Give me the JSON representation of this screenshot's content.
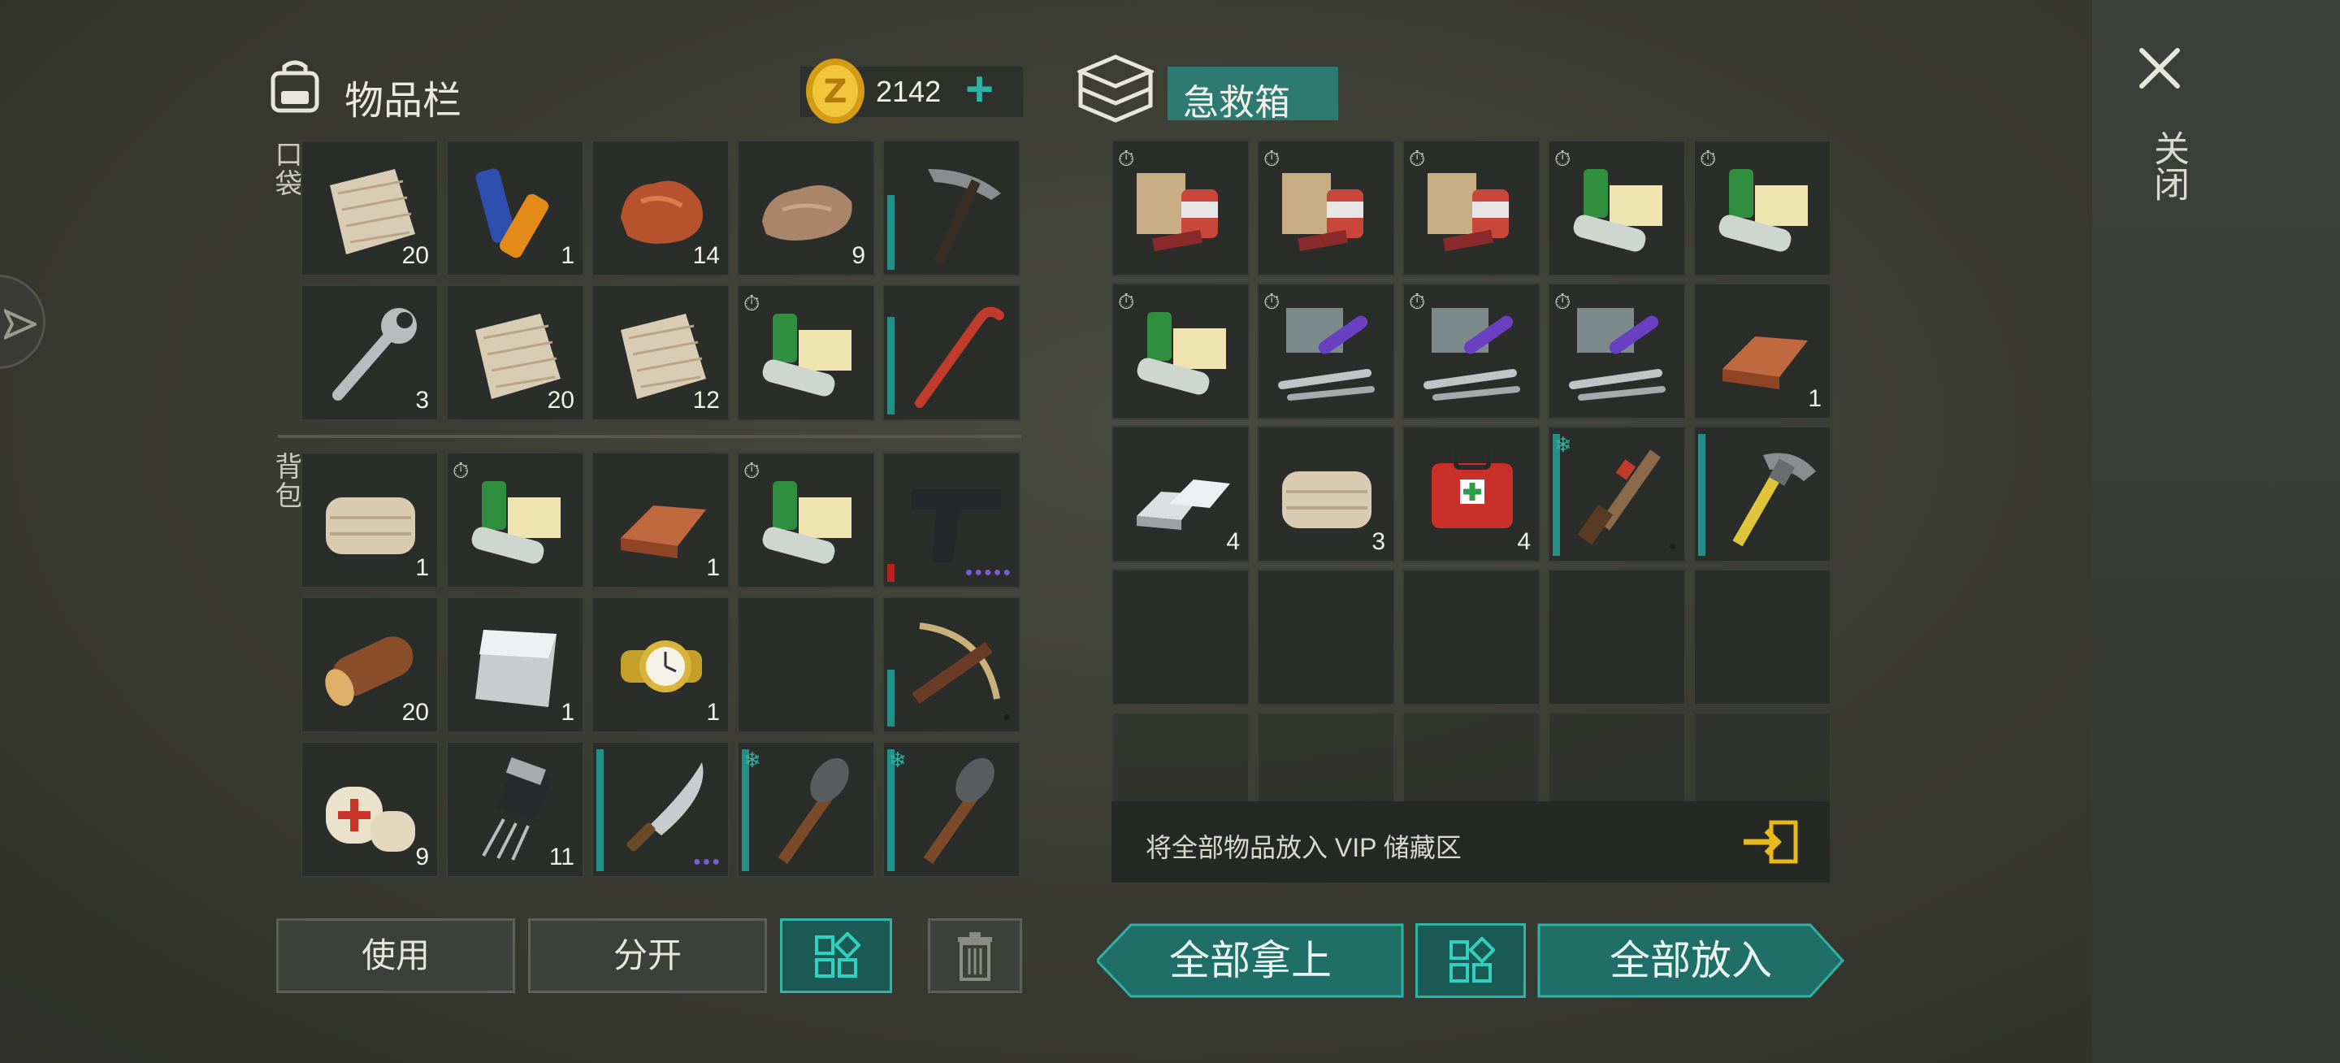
{
  "inventory": {
    "title": "物品栏",
    "coins": "2142",
    "plus": "+",
    "pocket_label": "口袋",
    "backpack_label": "背包",
    "pocket_slots": [
      {
        "icon": "burlap-cloth-icon",
        "count": "20"
      },
      {
        "icon": "batteries-icon",
        "count": "1"
      },
      {
        "icon": "copper-ore-icon",
        "count": "14"
      },
      {
        "icon": "stone-icon",
        "count": "9"
      },
      {
        "icon": "pickaxe-icon",
        "count": ""
      },
      {
        "icon": "wrench-icon",
        "count": "3"
      },
      {
        "icon": "burlap-cloth-icon",
        "count": "20"
      },
      {
        "icon": "burlap-cloth-icon",
        "count": "12"
      },
      {
        "icon": "medicine-kit-icon",
        "count": ""
      },
      {
        "icon": "crowbar-icon",
        "count": ""
      }
    ],
    "backpack_slots": [
      {
        "icon": "fabric-roll-icon",
        "count": "1"
      },
      {
        "icon": "medicine-kit-icon",
        "count": ""
      },
      {
        "icon": "copper-bar-icon",
        "count": "1"
      },
      {
        "icon": "medicine-kit-icon",
        "count": ""
      },
      {
        "icon": "pistol-icon",
        "count": ""
      },
      {
        "icon": "wood-log-icon",
        "count": "20"
      },
      {
        "icon": "metal-sheet-icon",
        "count": "1"
      },
      {
        "icon": "gold-watch-icon",
        "count": "1"
      },
      {
        "icon": "empty-slot",
        "count": ""
      },
      {
        "icon": "crossbow-icon",
        "count": ""
      },
      {
        "icon": "bandage-icon",
        "count": "9"
      },
      {
        "icon": "transistor-icon",
        "count": "11"
      },
      {
        "icon": "machete-icon",
        "count": ""
      },
      {
        "icon": "spiked-club-icon",
        "count": ""
      },
      {
        "icon": "spiked-club-icon",
        "count": ""
      }
    ],
    "buttons": {
      "use": "使用",
      "split": "分开"
    }
  },
  "first_aid": {
    "title": "急救箱",
    "slots": [
      {
        "icon": "food-pack-icon",
        "count": ""
      },
      {
        "icon": "food-pack-icon",
        "count": ""
      },
      {
        "icon": "food-pack-icon",
        "count": ""
      },
      {
        "icon": "medicine-kit-icon",
        "count": ""
      },
      {
        "icon": "medicine-kit-icon",
        "count": ""
      },
      {
        "icon": "medicine-kit-icon",
        "count": ""
      },
      {
        "icon": "toolset-icon",
        "count": ""
      },
      {
        "icon": "toolset-icon",
        "count": ""
      },
      {
        "icon": "toolset-icon",
        "count": ""
      },
      {
        "icon": "copper-bar-icon",
        "count": "1"
      },
      {
        "icon": "aluminum-bar-icon",
        "count": "4"
      },
      {
        "icon": "fabric-roll-icon",
        "count": "3"
      },
      {
        "icon": "first-aid-kit-icon",
        "count": "4"
      },
      {
        "icon": "shotgun-icon",
        "count": ""
      },
      {
        "icon": "hammer-icon",
        "count": ""
      }
    ],
    "vip_text": "将全部物品放入 VIP 储藏区",
    "buttons": {
      "take_all": "全部拿上",
      "put_all": "全部放入"
    }
  },
  "close": {
    "label": "关闭"
  },
  "colors": {
    "accent": "#2fb3a4",
    "durability": "#248f88",
    "durability_low": "#b3251e"
  }
}
